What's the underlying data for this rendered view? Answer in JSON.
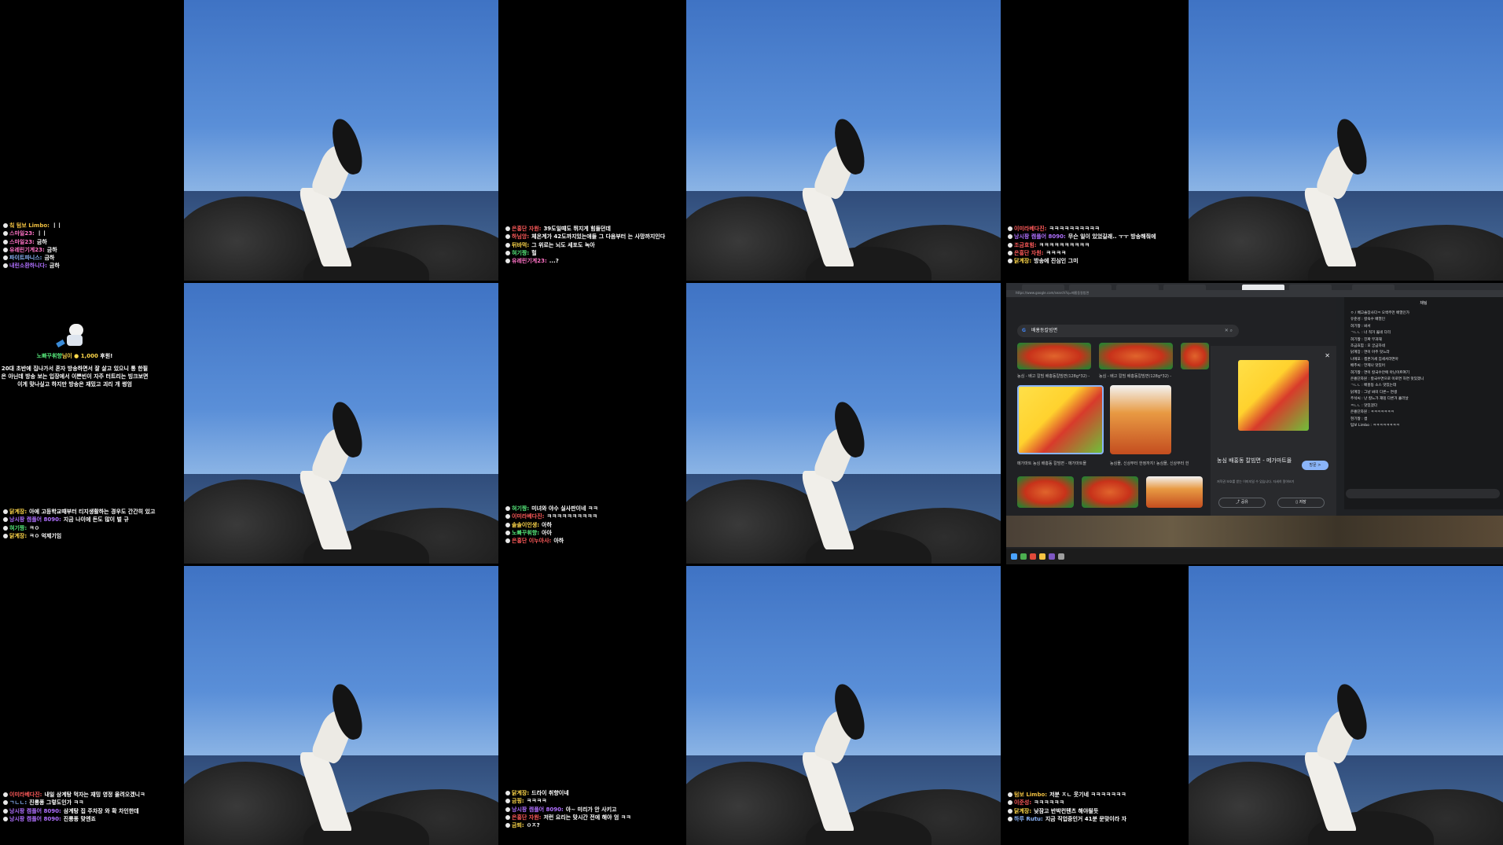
{
  "chat_panels": [
    {
      "id": "r1c1",
      "messages": [
        {
          "nick": "칰 텀보 Limbo",
          "color": "#f0c040",
          "text": "ㅣㅣ"
        },
        {
          "nick": "스마일23",
          "color": "#ff72c6",
          "text": "ㅣㅣ"
        },
        {
          "nick": "스마일23",
          "color": "#ff72c6",
          "text": "금하"
        },
        {
          "nick": "유레린기계23",
          "color": "#ff72c6",
          "text": "금하"
        },
        {
          "nick": "파이트파니스",
          "color": "#8ab4f8",
          "text": "금하"
        },
        {
          "nick": "내린소환하니다",
          "color": "#b070ff",
          "text": "금하"
        }
      ]
    },
    {
      "id": "r1c3",
      "messages": [
        {
          "nick": "은횽단 자원",
          "color": "#ff5a5a",
          "text": "39도일때도 뛰지게 힘들던데"
        },
        {
          "nick": "하님앙",
          "color": "#ff5a5a",
          "text": "체온계가 42도까지있는애들 그 다음부터 는 사망까지인다"
        },
        {
          "nick": "뒤바먹",
          "color": "#ffd84a",
          "text": "그 위로는 뇌도 세포도 녹아"
        },
        {
          "nick": "혀기짱",
          "color": "#56e77a",
          "text": "헐"
        },
        {
          "nick": "유레린기계23",
          "color": "#ff72c6",
          "text": "...?"
        }
      ]
    },
    {
      "id": "r1c5",
      "messages": [
        {
          "nick": "이미라베다진",
          "color": "#ff5a5a",
          "text": "ㅋㅋㅋㅋㅋㅋㅋㅋㅋㅋ"
        },
        {
          "nick": "낭시팡 켐플어 8090",
          "color": "#b070ff",
          "text": "무슨 일이 있었길래.. ㅜㅜ 방송해줘에"
        },
        {
          "nick": "조금효힘",
          "color": "#ff5a5a",
          "text": "ㅋㅋㅋㅋㅋㅋㅋㅋㅋㅋ"
        },
        {
          "nick": "은횽단 자원",
          "color": "#ff5a5a",
          "text": "ㅋㅋㅋㅋ"
        },
        {
          "nick": "닭계장",
          "color": "#ffd84a",
          "text": "방송에 진심인 그미"
        }
      ]
    },
    {
      "id": "r2c1",
      "messages": [
        {
          "nick": "닭계장",
          "color": "#ffd84a",
          "text": "아에 고등학교때부터 티지생활하는 경우도 간간히 있고"
        },
        {
          "nick": "낭시팡 켐플어 8090",
          "color": "#b070ff",
          "text": "지금 나이에 돈도 많이 벌 규"
        },
        {
          "nick": "혀기짱",
          "color": "#56e77a",
          "text": "ㅋㅇ"
        },
        {
          "nick": "닭계장",
          "color": "#ffd84a",
          "text": "ㅋㅇ 억제기임"
        }
      ]
    },
    {
      "id": "r2c3",
      "messages": [
        {
          "nick": "혀기짱",
          "color": "#56e77a",
          "text": "미녀와 야수 실사판이네 ㅋㅋ"
        },
        {
          "nick": "이미라베다진",
          "color": "#ff5a5a",
          "text": "ㅋㅋㅋㅋㅋㅋㅋㅋㅋㅋ"
        },
        {
          "nick": "솔솔이인생",
          "color": "#ffd84a",
          "text": "아하"
        },
        {
          "nick": "노빠꾸휘향",
          "color": "#56e77a",
          "text": "아아"
        },
        {
          "nick": "은횽단 이누아사",
          "color": "#ff5a5a",
          "text": "아하"
        }
      ]
    },
    {
      "id": "r3c1",
      "messages": [
        {
          "nick": "이미라베다진",
          "color": "#ff5a5a",
          "text": "내일 삼계탕 먹자는 재밍 영정 올려오겠니ㅋ"
        },
        {
          "nick": "ㄱㄴㄴ",
          "color": "#8ab4f8",
          "text": "진룡퐁 그렇도인가 ㅋㅋ"
        },
        {
          "nick": "낭시팡 켐플어 8090",
          "color": "#b070ff",
          "text": "삼계탕 집 주차장 와 확 차인한데"
        },
        {
          "nick": "낭시팡 켐플어 8090",
          "color": "#b070ff",
          "text": "진룡퐁 맞엔죠"
        }
      ]
    },
    {
      "id": "r3c3",
      "messages": [
        {
          "nick": "닭계장",
          "color": "#ffd84a",
          "text": "드라이 취향이네"
        },
        {
          "nick": "금핑",
          "color": "#ffd84a",
          "text": "ㅋㅋㅋㅋ"
        },
        {
          "nick": "낭시팡 켐플어 8090",
          "color": "#b070ff",
          "text": "아~ 미리가 안 사키고"
        },
        {
          "nick": "은횽단 자원",
          "color": "#ff5a5a",
          "text": "저런 요리는 맞시간 전에 해야 엄 ㅋㅋ"
        },
        {
          "nick": "금퇴",
          "color": "#ffd84a",
          "text": "ㅇㅈ?"
        }
      ]
    },
    {
      "id": "r3c5",
      "messages": [
        {
          "nick": "텀보 Limbo",
          "color": "#f0c040",
          "text": "저분 ㅈㄴ 웃기네 ㅋㅋㅋㅋㅋㅋㅋ"
        },
        {
          "nick": "이준성",
          "color": "#ff5a5a",
          "text": "ㅋㅋㅋㅋㅋㅋ"
        },
        {
          "nick": "닭계장",
          "color": "#ffd84a",
          "text": "낮잠고 반박컨텐츠 해야될듯"
        },
        {
          "nick": "하루 Rutu",
          "color": "#8ab4f8",
          "text": "지금 직업중인거 41분 문맞이라 자"
        }
      ]
    }
  ],
  "donation": {
    "donor": "노빠꾸휘향",
    "suffix": "님이",
    "amount": "1,000",
    "unit": "후원!",
    "message": "20대 초반에 집나가서 혼자 방송하면서 잘 살고 있으니 통 한필은 아닌데 방송 보는 입장에서 이쁜빈이 자주 터트리는 빙크보면 이게 맞나싶고 하지만 방송은 재밌고 괴리 개 썽엄"
  },
  "browser": {
    "search_query": "배홍동칼빔면",
    "url": "https://www.google.com/search?q=배홍동칼빔면",
    "thumb_captions": [
      "농심 - 배고 칼빔 배홍동칼빔면(128g*32) - 농...",
      "농심 - 배고 칼빔 배홍동칼빔면(128g*32) - 농...",
      "메가마트 농심 배홍동 칼빔면 - 메가마트몰",
      "농심몰, 신상부터 한정까지! 농심몰, 신상부터 한정까지!"
    ],
    "preview": {
      "title": "농심 배홍동 칼빔면 - 메가마트몰",
      "visit_label": "방문 >",
      "share_label": "공유",
      "save_label": "저장",
      "note": "저작권 보호를 받는 이미지일 수 있습니다. 자세히 알아보기"
    },
    "side_chat": {
      "header": "채팅",
      "lines": [
        "ㅇ / 배고솔장사다ㅋ 오싹주먼 배열인가",
        "유준성 : 칼숙수 배열인",
        "혀기짱 : 봐서",
        "ㄱㄴㄴ : 너 적거 옳네 다리",
        "혀기짱 : 진짜 무과재",
        "조금효힘 : 모 궁금하네",
        "닭계장 : 면이 아주 맛느라",
        "나에포 : 켐몬거세 집세서라면아",
        "배추씨 : 언제나 맛있어",
        "혀기짱 : 면이 칼국수안에 아닌이트여기",
        "은횽단자원 : 칼국수면으로 이로면 하면 맛있겠니",
        "ㄱㄴㄴ : 배홍동 소스 맛있는데",
        "닭계장 : 그냥 봐미 다른~ 면생",
        "주석씨 : 난 칼느가 재밍 다른거 흘러날",
        "ㅋㄴㄴ : 맛있겠다",
        "은횽단자원 : ㅋㅋㅋㅋㅋㅋㅋ",
        "현기짱 : 썸",
        "텀보 Limbo : ㅋㅋㅋㅋㅋㅋㅋㅋ"
      ]
    }
  }
}
